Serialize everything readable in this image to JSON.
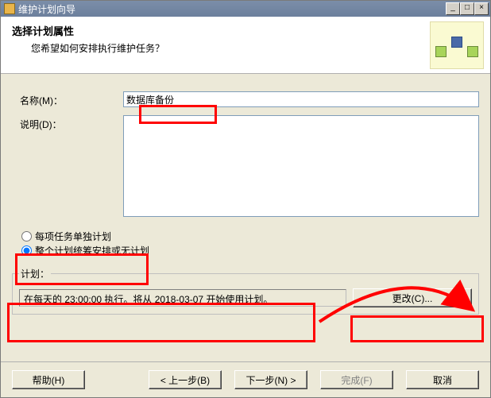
{
  "window": {
    "title": "维护计划向导",
    "min_label": "_",
    "max_label": "□",
    "close_label": "×"
  },
  "header": {
    "title": "选择计划属性",
    "subtitle": "您希望如何安排执行维护任务？"
  },
  "fields": {
    "name_label": "名称(M)：",
    "name_value": "数据库备份",
    "desc_label": "说明(D)：",
    "desc_value": ""
  },
  "schedule_mode": {
    "per_task": "每项任务单独计划",
    "whole_plan": "整个计划统筹安排或无计划",
    "selected": "whole_plan"
  },
  "schedule": {
    "legend": "计划：",
    "text": "在每天的 23:00:00 执行。将从 2018-03-07 开始使用计划。",
    "change_label": "更改(C)..."
  },
  "footer": {
    "help": "帮助(H)",
    "back": "< 上一步(B)",
    "next": "下一步(N) >",
    "finish": "完成(F)",
    "cancel": "取消"
  }
}
